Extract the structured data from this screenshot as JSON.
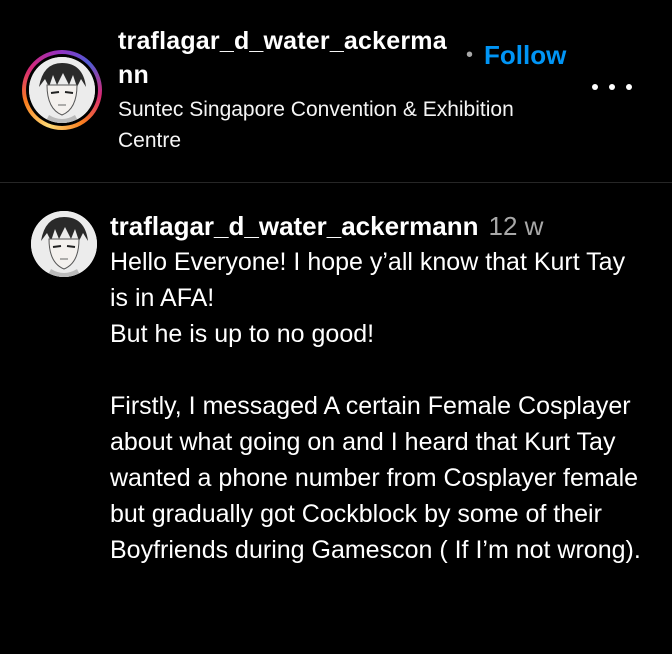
{
  "post_header": {
    "username": "traflagar_d_water_ackermann",
    "separator": "•",
    "follow_label": "Follow",
    "location": "Suntec Singapore Convention & Exhibition Centre",
    "more_icon": "more-horizontal-icon"
  },
  "comment": {
    "username": "traflagar_d_water_ackermann",
    "time": "12 w",
    "text": "Hello Everyone! I hope y’all know that Kurt Tay is in AFA!\nBut he is up to no good!\n\nFirstly, I messaged A certain Female Cosplayer about what going on and I heard that Kurt Tay wanted a phone number from Cosplayer female but gradually got Cockblock by some of their Boyfriends during Gamescon ( If I’m not wrong)."
  },
  "colors": {
    "background": "#000000",
    "follow": "#0095f6",
    "muted": "#a8a8a8",
    "divider": "#262626"
  }
}
